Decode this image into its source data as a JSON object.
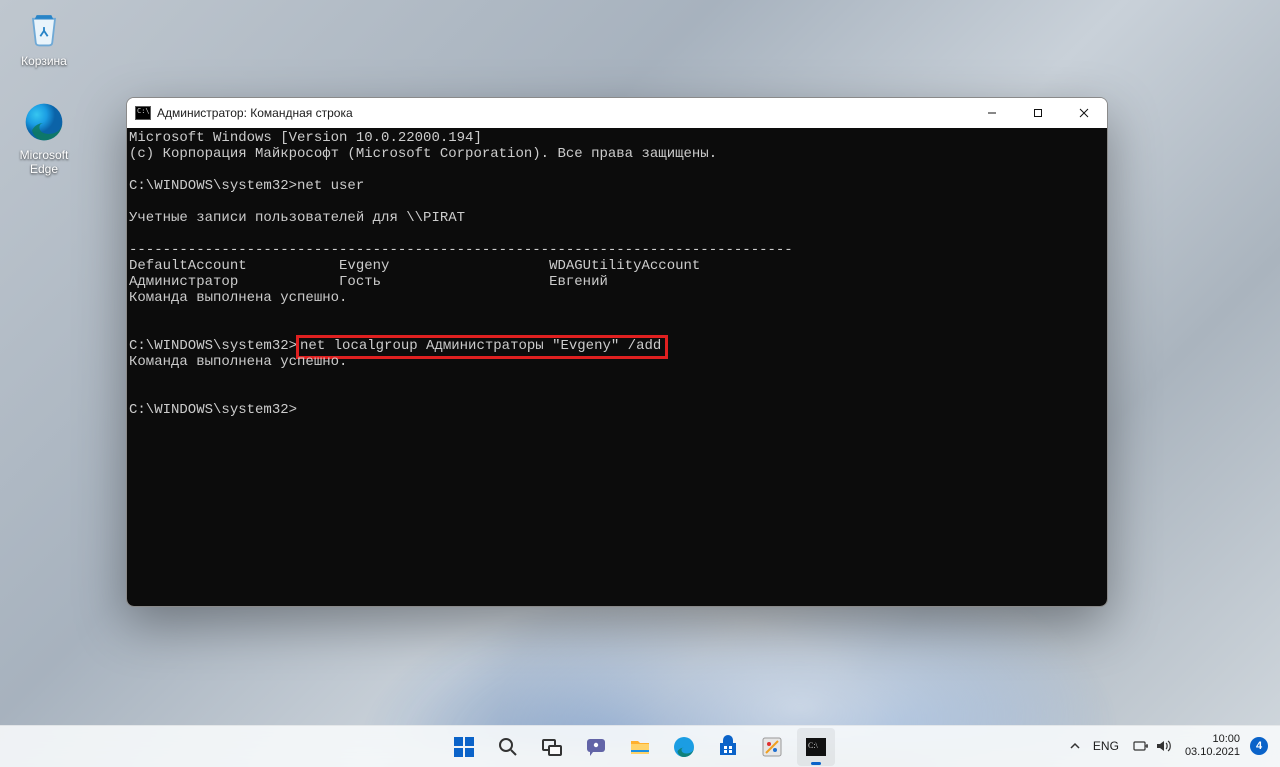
{
  "desktop": {
    "icons": [
      {
        "name": "recycle-bin",
        "label": "Корзина"
      },
      {
        "name": "microsoft-edge",
        "label": "Microsoft Edge"
      }
    ]
  },
  "cmd": {
    "title": "Администратор: Командная строка",
    "lines": {
      "ver": "Microsoft Windows [Version 10.0.22000.194]",
      "copyright": "(c) Корпорация Майкрософт (Microsoft Corporation). Все права защищены.",
      "blank": "",
      "prompt1": "C:\\WINDOWS\\system32>net user",
      "acct_hdr": "Учетные записи пользователей для \\\\PIRAT",
      "rule": "-------------------------------------------------------------------------------",
      "row1": "DefaultAccount           Evgeny                   WDAGUtilityAccount",
      "row2": "Администратор            Гость                    Евгений",
      "ok1": "Команда выполнена успешно.",
      "prompt2a": "C:\\WINDOWS\\system32>",
      "prompt2b": "net localgroup Администраторы \"Evgeny\" /add",
      "ok2": "Команда выполнена успешно.",
      "prompt3": "C:\\WINDOWS\\system32>"
    }
  },
  "taskbar": {
    "items": [
      "start",
      "search",
      "task-view",
      "chat",
      "file-explorer",
      "edge",
      "store",
      "paint",
      "cmd"
    ]
  },
  "tray": {
    "lang": "ENG",
    "time": "10:00",
    "date": "03.10.2021",
    "notif_count": "4"
  }
}
